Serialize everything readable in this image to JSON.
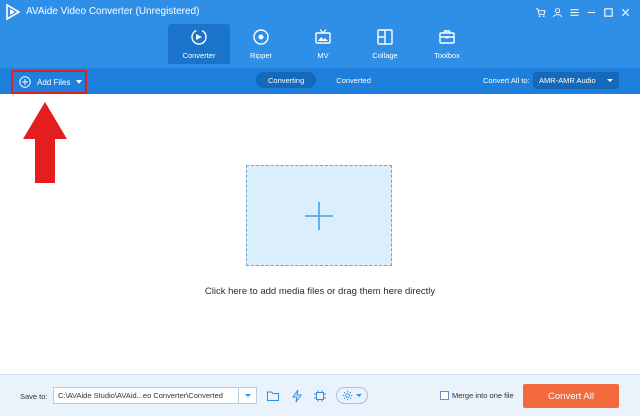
{
  "window": {
    "title": "AVAide Video Converter (Unregistered)",
    "controls": [
      "cart-icon",
      "user-icon",
      "menu-icon",
      "minimize-icon",
      "maximize-icon",
      "close-icon"
    ]
  },
  "nav": {
    "items": [
      {
        "label": "Converter",
        "icon": "converter-icon",
        "active": true
      },
      {
        "label": "Ripper",
        "icon": "disc-icon",
        "active": false
      },
      {
        "label": "MV",
        "icon": "tv-icon",
        "active": false
      },
      {
        "label": "Collage",
        "icon": "collage-icon",
        "active": false
      },
      {
        "label": "Toolbox",
        "icon": "toolbox-icon",
        "active": false
      }
    ]
  },
  "toolbar": {
    "add_files_label": "Add Files",
    "tabs": [
      {
        "label": "Converting",
        "active": true
      },
      {
        "label": "Converted",
        "active": false
      }
    ],
    "convert_all_label": "Convert All to:",
    "format_value": "AMR-AMR Audio"
  },
  "main": {
    "drop_text": "Click here to add media files or drag them here directly"
  },
  "bottom": {
    "save_label": "Save to:",
    "save_path": "C:\\AVAide Studio\\AVAid...eo Converter\\Converted",
    "merge_label": "Merge into one file",
    "merge_checked": false,
    "convert_all_button": "Convert All"
  },
  "colors": {
    "header_blue": "#2f8fe6",
    "toolbar_blue": "#1e7fdc",
    "accent_orange": "#f26a3d",
    "annotation_red": "#e02020"
  }
}
